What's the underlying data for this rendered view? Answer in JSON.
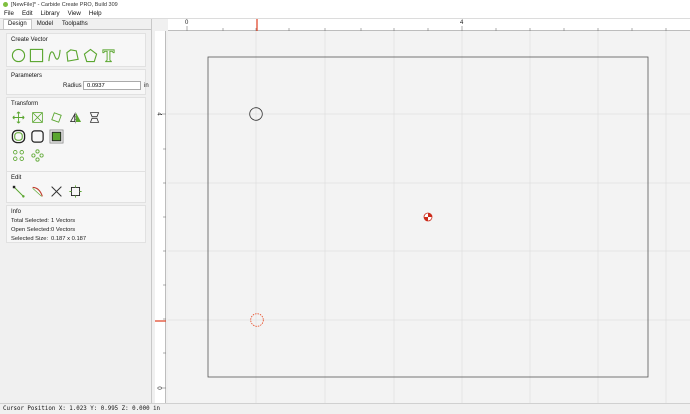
{
  "window": {
    "title": "[NewFile]* - Carbide Create PRO, Build 309"
  },
  "menu": [
    "File",
    "Edit",
    "Library",
    "View",
    "Help"
  ],
  "tabs": [
    "Design",
    "Model",
    "Toolpaths"
  ],
  "create_vector": {
    "title": "Create Vector",
    "tools": [
      "circle-icon",
      "rectangle-icon",
      "curve-icon",
      "polyline-icon",
      "polygon-icon",
      "text-icon"
    ]
  },
  "parameters": {
    "title": "Parameters",
    "radius_label": "Radius",
    "radius_value": "0.0937",
    "unit": "in"
  },
  "transform": {
    "title": "Transform",
    "tools": [
      "move-icon",
      "scale-icon",
      "rotate-icon",
      "mirror-icon",
      "align-icon",
      "offset-icon",
      "fillet-icon",
      "boolean-icon",
      "array-icon",
      "circular-array-icon"
    ]
  },
  "edit": {
    "title": "Edit",
    "tools": [
      "node-edit-icon",
      "smooth-icon",
      "trim-icon",
      "bounding-box-icon"
    ]
  },
  "info": {
    "title": "Info",
    "rows": [
      {
        "label": "Total Selected:",
        "value": "1 Vectors"
      },
      {
        "label": "Open Selected:",
        "value": "0 Vectors"
      },
      {
        "label": "Selected Size:",
        "value": "0.187 x 0.187"
      }
    ]
  },
  "rulers": {
    "top_labels": [
      "0",
      "4"
    ],
    "left_labels": [
      "4",
      "0"
    ]
  },
  "status": {
    "text": "Cursor Position X: 1.023 Y: 0.995 Z: 0.000 in"
  },
  "colors": {
    "accent": "#6abf3a",
    "selection": "#e8441d",
    "grid": "#d9d9d9"
  }
}
